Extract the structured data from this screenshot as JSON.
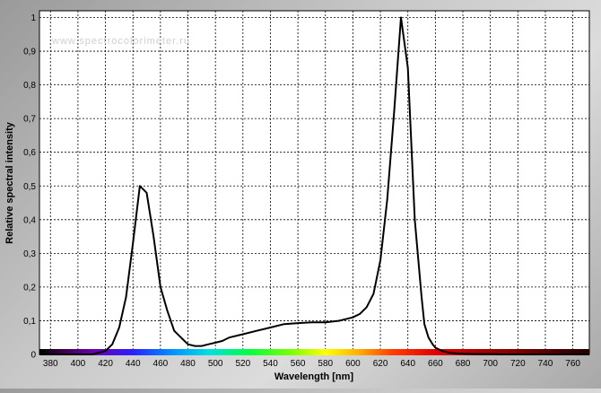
{
  "watermark": "www.spectrocolorimeter.ru",
  "chart_data": {
    "type": "line",
    "xlabel": "Wavelength [nm]",
    "ylabel": "Relative spectral intensity",
    "xlim": [
      372,
      772
    ],
    "ylim": [
      0,
      1.02
    ],
    "x_ticks": [
      "380",
      "400",
      "420",
      "440",
      "460",
      "480",
      "500",
      "520",
      "540",
      "560",
      "580",
      "600",
      "620",
      "640",
      "660",
      "680",
      "700",
      "720",
      "740",
      "760"
    ],
    "y_ticks": [
      "0",
      "0,1",
      "0,2",
      "0,3",
      "0,4",
      "0,5",
      "0,6",
      "0,7",
      "0,8",
      "0,9",
      "1"
    ],
    "grid": true,
    "spectrum_bar": true,
    "line_color": "#000000",
    "series": [
      {
        "x": [
          372,
          380,
          390,
          400,
          410,
          420,
          425,
          430,
          435,
          440,
          445,
          450,
          455,
          460,
          465,
          470,
          475,
          480,
          485,
          490,
          495,
          500,
          505,
          510,
          520,
          530,
          540,
          550,
          560,
          570,
          580,
          590,
          600,
          605,
          610,
          615,
          620,
          625,
          630,
          635,
          640,
          645,
          650,
          652,
          655,
          658,
          660,
          665,
          670,
          675,
          680,
          690,
          700,
          710,
          720,
          730,
          740,
          750,
          760,
          772
        ],
        "y": [
          0,
          0,
          0,
          0,
          0,
          0.01,
          0.03,
          0.08,
          0.17,
          0.33,
          0.5,
          0.48,
          0.35,
          0.2,
          0.13,
          0.07,
          0.05,
          0.03,
          0.025,
          0.025,
          0.03,
          0.035,
          0.04,
          0.05,
          0.06,
          0.07,
          0.08,
          0.09,
          0.093,
          0.095,
          0.095,
          0.1,
          0.11,
          0.12,
          0.14,
          0.18,
          0.28,
          0.46,
          0.72,
          1.0,
          0.85,
          0.4,
          0.17,
          0.09,
          0.05,
          0.03,
          0.02,
          0.01,
          0.005,
          0.003,
          0.002,
          0.001,
          0.001,
          0,
          0,
          0,
          0,
          0,
          0,
          0
        ]
      }
    ]
  }
}
